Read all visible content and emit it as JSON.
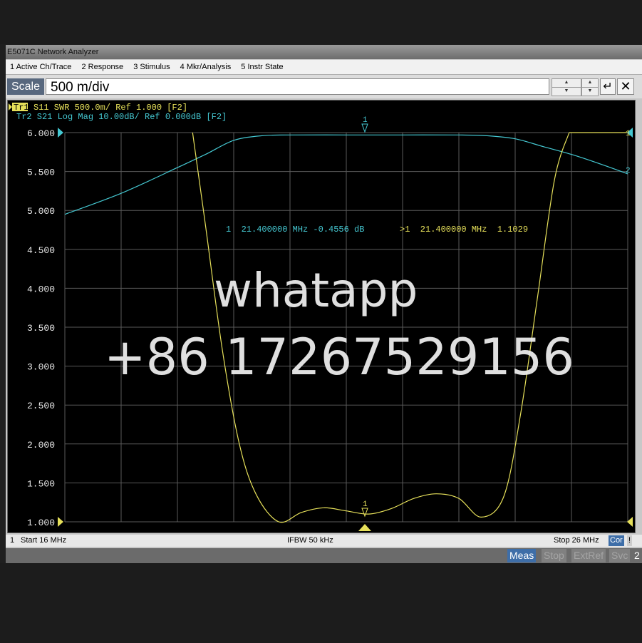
{
  "window": {
    "title": "E5071C Network Analyzer"
  },
  "menu": [
    "1 Active Ch/Trace",
    "2 Response",
    "3 Stimulus",
    "4 Mkr/Analysis",
    "5 Instr State"
  ],
  "entry": {
    "label": "Scale",
    "value": "500 m/div",
    "enter_symbol": "↵",
    "close_symbol": "✕"
  },
  "traces": {
    "tr1_label": "Tr1",
    "tr1": "S11  SWR 500.0m/ Ref 1.000 [F2]",
    "tr2": "Tr2  S21 Log Mag 10.00dB/ Ref 0.000dB [F2]"
  },
  "marker_readout": {
    "m1": "1  21.400000 MHz -0.4556 dB",
    "m2": ">1  21.400000 MHz  1.1029"
  },
  "markers": {
    "top": "1",
    "bottom": "1",
    "right_tr1": "1",
    "right_tr2": "2"
  },
  "y_ticks": [
    "6.000",
    "5.500",
    "5.000",
    "4.500",
    "4.000",
    "3.500",
    "3.000",
    "2.500",
    "2.000",
    "1.500",
    "1.000"
  ],
  "status": {
    "channel": "1",
    "start": "Start 16 MHz",
    "ifbw": "IFBW 50 kHz",
    "stop": "Stop 26 MHz",
    "cor": "Cor",
    "excl": "!"
  },
  "softkeys": {
    "meas": "Meas",
    "stop": "Stop",
    "extref": "ExtRef",
    "svc": "Svc",
    "num": "2"
  },
  "watermark": {
    "line1": "whatapp",
    "line2": "+86 17267529156"
  },
  "colors": {
    "trace_swr": "#e6e05a",
    "trace_logmag": "#45c8d2",
    "grid": "#5a5a5a",
    "meas_key": "#3e6ea8"
  },
  "chart_data": {
    "type": "line",
    "x_range": [
      16,
      26
    ],
    "ylim": [
      1.0,
      6.0
    ],
    "series": [
      {
        "name": "S11 SWR",
        "x": [
          18.27,
          18.5,
          18.8,
          19.1,
          19.4,
          19.8,
          20.2,
          20.6,
          21.0,
          21.4,
          21.8,
          22.2,
          22.6,
          23.0,
          23.4,
          23.8,
          24.1,
          24.4,
          24.7,
          24.96
        ],
        "values": [
          6.0,
          4.8,
          3.2,
          2.0,
          1.35,
          1.0,
          1.12,
          1.18,
          1.14,
          1.1,
          1.17,
          1.3,
          1.36,
          1.3,
          1.06,
          1.33,
          2.4,
          3.9,
          5.4,
          6.0
        ]
      },
      {
        "name": "S21 Log Mag",
        "x": [
          16,
          17,
          18,
          18.5,
          19,
          19.5,
          20,
          21,
          22,
          23,
          23.5,
          24,
          24.5,
          25,
          25.5,
          26
        ],
        "values": [
          4.95,
          5.22,
          5.55,
          5.72,
          5.9,
          5.96,
          5.97,
          5.97,
          5.97,
          5.97,
          5.96,
          5.92,
          5.82,
          5.72,
          5.6,
          5.47
        ]
      }
    ]
  }
}
